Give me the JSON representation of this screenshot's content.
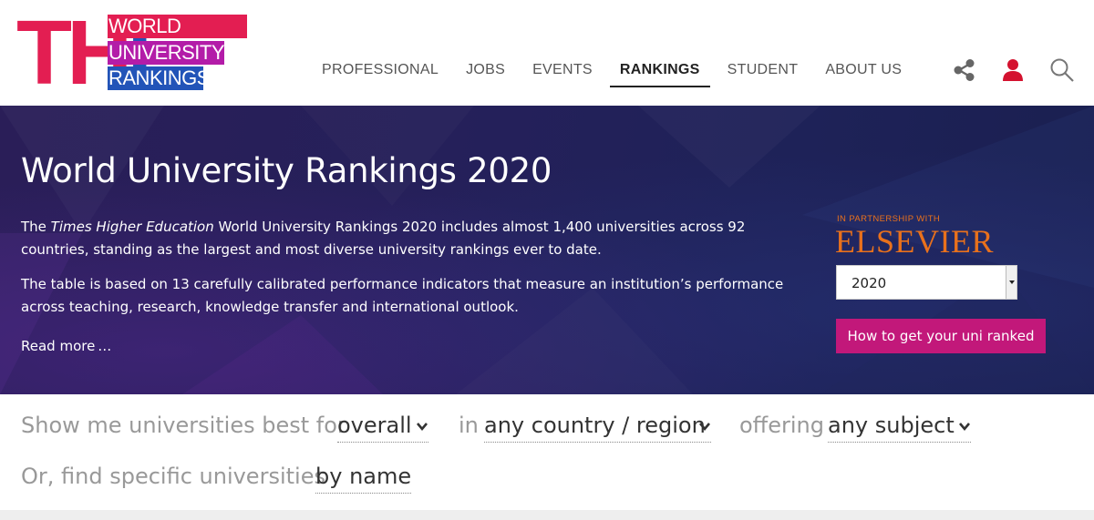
{
  "logo": {
    "letters": "THE",
    "line1": "WORLD",
    "line2": "UNIVERSITY",
    "line3": "RANKINGS"
  },
  "nav": {
    "items": [
      {
        "label": "PROFESSIONAL"
      },
      {
        "label": "JOBS"
      },
      {
        "label": "EVENTS"
      },
      {
        "label": "RANKINGS",
        "active": true
      },
      {
        "label": "STUDENT"
      },
      {
        "label": "ABOUT US"
      }
    ]
  },
  "header_icons": [
    "share-icon",
    "user-icon",
    "search-icon"
  ],
  "hero": {
    "title": "World University Rankings 2020",
    "p1_pre": "The ",
    "p1_em": "Times Higher Education",
    "p1_post": " World University Rankings 2020 includes almost 1,400 universities across 92 countries, standing as the largest and most diverse university rankings ever to date.",
    "p2": "The table is based on 13 carefully calibrated performance indicators that measure an institution’s performance across teaching, research, knowledge transfer and international outlook.",
    "read_more": "Read more …",
    "partner_label": "IN PARTNERSHIP WITH",
    "partner_name": "ELSEVIER",
    "year": "2020",
    "rank_button": "How to get your uni ranked"
  },
  "filter": {
    "text1": "Show me universities best for",
    "sel1": "overall",
    "text2": "in",
    "sel2": "any country / region",
    "text3": "offering",
    "sel3": "any subject",
    "text4": "Or, find specific universities",
    "sel4": "by name"
  },
  "colors": {
    "brand_red": "#e31e52",
    "brand_purple": "#b31ca8",
    "brand_blue": "#2254b8",
    "cta_magenta": "#c2187a",
    "elsevier_orange": "#e9711c"
  }
}
